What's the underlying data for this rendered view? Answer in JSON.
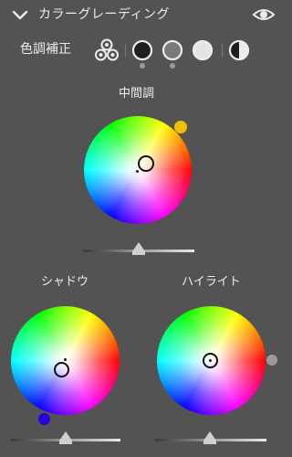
{
  "header": {
    "title": "カラーグレーディング"
  },
  "mode_bar": {
    "label": "色調補正",
    "selected": "shadow"
  },
  "wheels": {
    "midtones": {
      "label": "中間調",
      "swatch_color": "#f0c000",
      "slider_value_pct": 50
    },
    "shadows": {
      "label": "シャドウ",
      "swatch_color": "#2a00d8",
      "slider_value_pct": 48
    },
    "highlights": {
      "label": "ハイライト",
      "swatch_color": "#9a9a9a",
      "slider_value_pct": 47
    }
  },
  "colors": {
    "panel_bg": "#535353",
    "text": "#ececec",
    "selected_indicator": "#9a9a9a"
  }
}
